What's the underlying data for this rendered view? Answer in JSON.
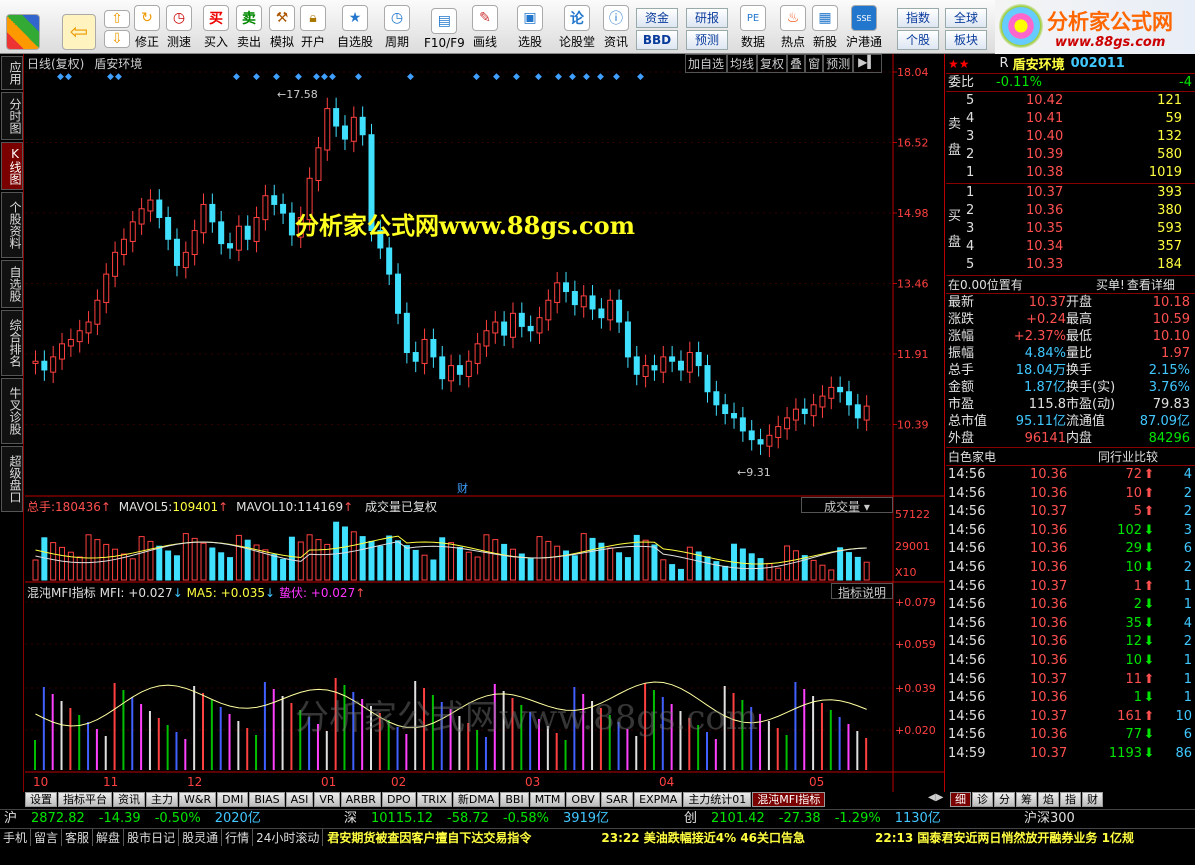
{
  "toolbar": {
    "buttons": [
      "修正",
      "测速",
      "买入",
      "卖出",
      "模拟",
      "开户",
      "自选股",
      "周期",
      "F10/F9",
      "画线",
      "选股",
      "论股堂",
      "资讯",
      "数据",
      "热点",
      "新股",
      "沪港通"
    ],
    "mini": [
      "资金",
      "研报",
      "BBD",
      "预测",
      "指数",
      "全球",
      "个股",
      "板块"
    ],
    "brand_title": "分析家公式网",
    "brand_url": "www.88gs.com"
  },
  "left_tabs": [
    "应用",
    "分时图",
    "K线图",
    "个股资料",
    "自选股",
    "综合排名",
    "牛叉诊股",
    "超级盘口"
  ],
  "chart": {
    "header_left": "日线(复权)",
    "stock_name": "盾安环境",
    "header_buttons": [
      "加自选",
      "均线",
      "复权",
      "叠",
      "窗",
      "预测"
    ],
    "watermark": "分析家公式网www.88gs.com",
    "price_axis": [
      "18.04",
      "16.52",
      "14.98",
      "13.46",
      "11.91",
      "10.39"
    ],
    "high_label": "17.58",
    "low_label": "9.31",
    "cai": "财",
    "vol_header": {
      "total_label": "总手:",
      "total": "180436",
      "ma5_label": "MAVOL5:",
      "ma5": "109401",
      "ma10_label": "MAVOL10:",
      "ma10": "114169",
      "note": "成交量已复权",
      "btn": "成交量"
    },
    "vol_axis": [
      "57122",
      "29001",
      "X10"
    ],
    "mfi_header": {
      "name": "混沌MFI指标",
      "mfi": "MFI: +0.027",
      "ma5": "MA5: +0.035",
      "ambush": "蛰伏: +0.027",
      "btn": "指标说明"
    },
    "mfi_axis": [
      "+0.079",
      "+0.059",
      "+0.039",
      "+0.020"
    ],
    "months": [
      "10",
      "11",
      "12",
      "01",
      "02",
      "03",
      "04",
      "05",
      "06"
    ],
    "ghost_watermark": "分析家公式网www.88gs.com"
  },
  "quote": {
    "code_prefix": "R",
    "name": "盾安环境",
    "code": "002011",
    "webi_label": "委比",
    "webi": "-0.11%",
    "webi_diff": "-4",
    "sell_label": "卖盘",
    "buy_label": "买盘",
    "sell": [
      [
        "5",
        "10.42",
        "121"
      ],
      [
        "4",
        "10.41",
        "59"
      ],
      [
        "3",
        "10.40",
        "132"
      ],
      [
        "2",
        "10.39",
        "580"
      ],
      [
        "1",
        "10.38",
        "1019"
      ]
    ],
    "buy": [
      [
        "1",
        "10.37",
        "393"
      ],
      [
        "2",
        "10.36",
        "380"
      ],
      [
        "3",
        "10.35",
        "593"
      ],
      [
        "4",
        "10.34",
        "357"
      ],
      [
        "5",
        "10.33",
        "184"
      ]
    ],
    "position_note": "在0.00位置有",
    "buy_one": "买单!",
    "detail": "查看详细",
    "stats": [
      [
        "最新",
        "10.37",
        "开盘",
        "10.18"
      ],
      [
        "涨跌",
        "+0.24",
        "最高",
        "10.59"
      ],
      [
        "涨幅",
        "+2.37%",
        "最低",
        "10.10"
      ],
      [
        "振幅",
        "4.84%",
        "量比",
        "1.97"
      ],
      [
        "总手",
        "18.04万",
        "换手",
        "2.15%"
      ],
      [
        "金额",
        "1.87亿",
        "换手(实)",
        "3.76%"
      ],
      [
        "市盈",
        "115.8",
        "市盈(动)",
        "79.83"
      ],
      [
        "总市值",
        "95.11亿",
        "流通值",
        "87.09亿"
      ],
      [
        "外盘",
        "96141",
        "内盘",
        "84296"
      ]
    ],
    "industry": "白色家电",
    "industry_btn": "同行业比较",
    "ticks": [
      [
        "14:56",
        "10.36",
        "72",
        "up",
        "4"
      ],
      [
        "14:56",
        "10.36",
        "10",
        "up",
        "2"
      ],
      [
        "14:56",
        "10.37",
        "5",
        "up",
        "2"
      ],
      [
        "14:56",
        "10.36",
        "102",
        "dn",
        "3"
      ],
      [
        "14:56",
        "10.36",
        "29",
        "dn",
        "6"
      ],
      [
        "14:56",
        "10.36",
        "10",
        "dn",
        "2"
      ],
      [
        "14:56",
        "10.37",
        "1",
        "up",
        "1"
      ],
      [
        "14:56",
        "10.36",
        "2",
        "dn",
        "1"
      ],
      [
        "14:56",
        "10.36",
        "35",
        "dn",
        "4"
      ],
      [
        "14:56",
        "10.36",
        "12",
        "dn",
        "2"
      ],
      [
        "14:56",
        "10.36",
        "10",
        "dn",
        "1"
      ],
      [
        "14:56",
        "10.37",
        "11",
        "up",
        "1"
      ],
      [
        "14:56",
        "10.36",
        "1",
        "dn",
        "1"
      ],
      [
        "14:56",
        "10.37",
        "161",
        "up",
        "10"
      ],
      [
        "14:56",
        "10.36",
        "77",
        "dn",
        "6"
      ],
      [
        "14:59",
        "10.37",
        "1193",
        "dn",
        "86"
      ]
    ],
    "bottom_tabs": [
      "细",
      "诊",
      "分",
      "筹",
      "焰",
      "指",
      "财"
    ]
  },
  "indicator_tabs": [
    "设置",
    "指标平台",
    "资讯",
    "主力",
    "W&R",
    "DMI",
    "BIAS",
    "ASI",
    "VR",
    "ARBR",
    "DPO",
    "TRIX",
    "新DMA",
    "BBI",
    "MTM",
    "OBV",
    "SAR",
    "EXPMA",
    "主力统计01",
    "混沌MFI指标"
  ],
  "market": [
    {
      "name": "沪",
      "val": "2872.82",
      "chg": "-14.39",
      "pct": "-0.50%",
      "amt": "2020亿"
    },
    {
      "name": "深",
      "val": "10115.12",
      "chg": "-58.72",
      "pct": "-0.58%",
      "amt": "3919亿"
    },
    {
      "name": "创",
      "val": "2101.42",
      "chg": "-27.38",
      "pct": "-1.29%",
      "amt": "1130亿"
    },
    {
      "name": "沪深300",
      "val": "",
      "chg": "",
      "pct": "",
      "amt": ""
    }
  ],
  "status_tabs": [
    "手机",
    "留言",
    "客服",
    "解盘",
    "股市日记",
    "股灵通",
    "行情",
    "24小时滚动"
  ],
  "news": [
    "君安期货被查因客户擅自下达交易指令",
    "23:22 美油跌幅接近4% 46关口告急",
    "22:13 国泰君安近两日悄然放开融券业务 1亿规"
  ],
  "colors": {
    "up": "#ff4040",
    "down": "#40e0ff",
    "bg": "#000000",
    "accent": "#7a0000"
  }
}
